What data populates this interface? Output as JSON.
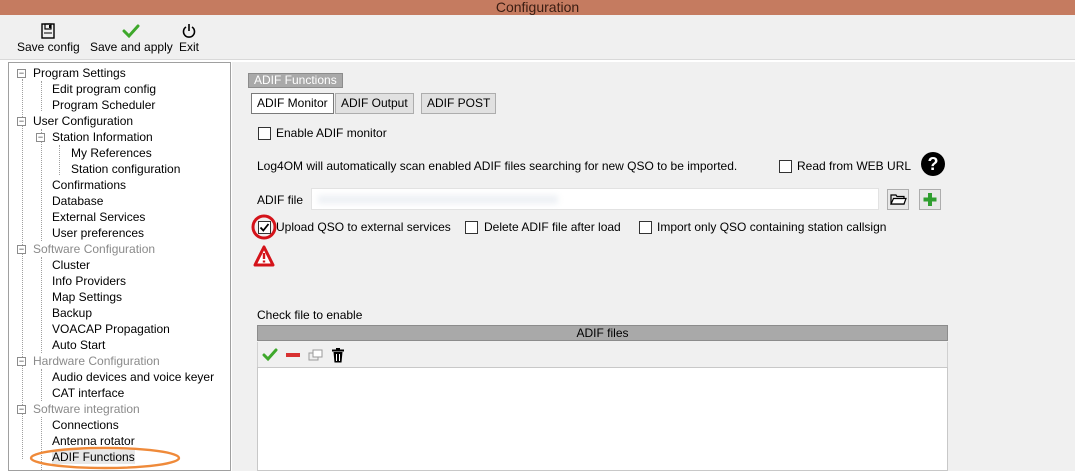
{
  "window": {
    "title": "Configuration"
  },
  "toolbar": {
    "save_config": "Save config",
    "save_and_apply": "Save and apply",
    "exit": "Exit",
    "save_icon": "floppy-disk-icon",
    "apply_icon": "green-check-icon",
    "exit_icon": "power-icon"
  },
  "tree": {
    "items": [
      {
        "label": "Program Settings"
      },
      {
        "label": "Edit program config"
      },
      {
        "label": "Program Scheduler"
      },
      {
        "label": "User Configuration"
      },
      {
        "label": "Station Information"
      },
      {
        "label": "My References"
      },
      {
        "label": "Station configuration"
      },
      {
        "label": "Confirmations"
      },
      {
        "label": "Database"
      },
      {
        "label": "External Services"
      },
      {
        "label": "User preferences"
      },
      {
        "label": "Software Configuration"
      },
      {
        "label": "Cluster"
      },
      {
        "label": "Info Providers"
      },
      {
        "label": "Map Settings"
      },
      {
        "label": "Backup"
      },
      {
        "label": "VOACAP Propagation"
      },
      {
        "label": "Auto Start"
      },
      {
        "label": "Hardware Configuration"
      },
      {
        "label": "Audio devices and voice keyer"
      },
      {
        "label": "CAT interface"
      },
      {
        "label": "Software integration"
      },
      {
        "label": "Connections"
      },
      {
        "label": "Antenna rotator"
      },
      {
        "label": "ADIF Functions"
      }
    ],
    "selected": "ADIF Functions"
  },
  "panel": {
    "group_title": "ADIF Functions",
    "tabs": [
      {
        "label": "ADIF Monitor",
        "active": true
      },
      {
        "label": "ADIF Output",
        "active": false
      },
      {
        "label": "ADIF POST",
        "active": false
      }
    ],
    "enable_monitor": {
      "label": "Enable ADIF monitor",
      "checked": false
    },
    "scan_text": "Log4OM will automatically scan enabled ADIF files searching for new QSO to be imported.",
    "read_from_web": {
      "label": "Read from WEB URL",
      "checked": false
    },
    "help_icon": "question-mark-icon",
    "adif_file_label": "ADIF file",
    "adif_file_value": "",
    "browse_icon": "folder-open-icon",
    "add_icon": "green-plus-icon",
    "upload_qso": {
      "label": "Upload QSO to external services",
      "checked": true
    },
    "delete_after_load": {
      "label": "Delete ADIF file after load",
      "checked": false
    },
    "import_only_station": {
      "label": "Import only QSO containing station callsign",
      "checked": false
    },
    "check_file_label": "Check file to enable",
    "grid_header": "ADIF files",
    "grid_icons": [
      "check-icon",
      "minus-icon",
      "copy-icon",
      "trash-icon"
    ]
  },
  "annotations": {
    "circle_color": "#d4131a",
    "warning_icon": "warning-triangle-icon",
    "tree_highlight_color": "#ef8a3a"
  }
}
